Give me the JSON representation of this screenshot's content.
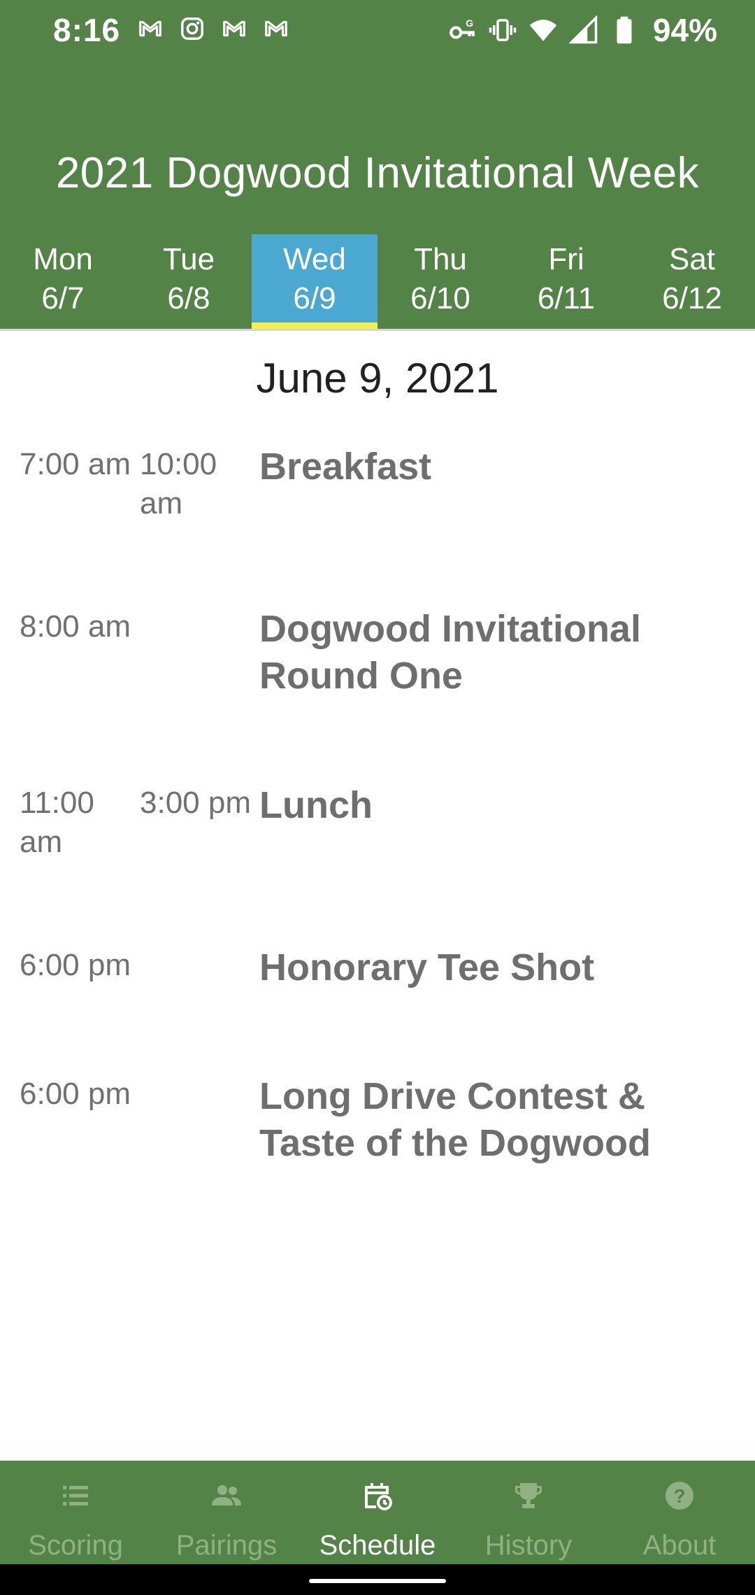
{
  "status_bar": {
    "time": "8:16",
    "notification_icons": [
      "gmail-icon",
      "instagram-icon",
      "gmail-icon",
      "gmail-icon"
    ],
    "system_icons": [
      "vpn-key-icon",
      "vibrate-icon",
      "wifi-icon",
      "cell-signal-icon",
      "battery-icon"
    ],
    "battery_percent": "94%"
  },
  "header": {
    "title": "2021 Dogwood Invitational Week",
    "day_tabs": [
      {
        "day": "Mon",
        "date": "6/7",
        "selected": false
      },
      {
        "day": "Tue",
        "date": "6/8",
        "selected": false
      },
      {
        "day": "Wed",
        "date": "6/9",
        "selected": true
      },
      {
        "day": "Thu",
        "date": "6/10",
        "selected": false
      },
      {
        "day": "Fri",
        "date": "6/11",
        "selected": false
      },
      {
        "day": "Sat",
        "date": "6/12",
        "selected": false
      }
    ]
  },
  "schedule": {
    "date_heading": "June 9, 2021",
    "events": [
      {
        "start": "7:00 am",
        "end": "10:00 am",
        "title": "Breakfast"
      },
      {
        "start": "8:00 am",
        "end": "",
        "title": "Dogwood Invitational Round One"
      },
      {
        "start": "11:00 am",
        "end": "3:00 pm",
        "title": "Lunch"
      },
      {
        "start": "6:00 pm",
        "end": "",
        "title": "Honorary Tee Shot"
      },
      {
        "start": "6:00 pm",
        "end": "",
        "title": "Long Drive Contest & Taste of the Dogwood"
      }
    ]
  },
  "bottom_nav": {
    "items": [
      {
        "label": "Scoring",
        "icon": "list-icon",
        "active": false
      },
      {
        "label": "Pairings",
        "icon": "people-icon",
        "active": false
      },
      {
        "label": "Schedule",
        "icon": "calendar-clock-icon",
        "active": true
      },
      {
        "label": "History",
        "icon": "trophy-icon",
        "active": false
      },
      {
        "label": "About",
        "icon": "help-icon",
        "active": false
      }
    ]
  },
  "colors": {
    "brand_green": "#548347",
    "selected_tab": "#4aa8d1",
    "tab_indicator": "#f6f04a",
    "inactive_nav": "#8fb184",
    "event_text": "#6e6e6e"
  }
}
